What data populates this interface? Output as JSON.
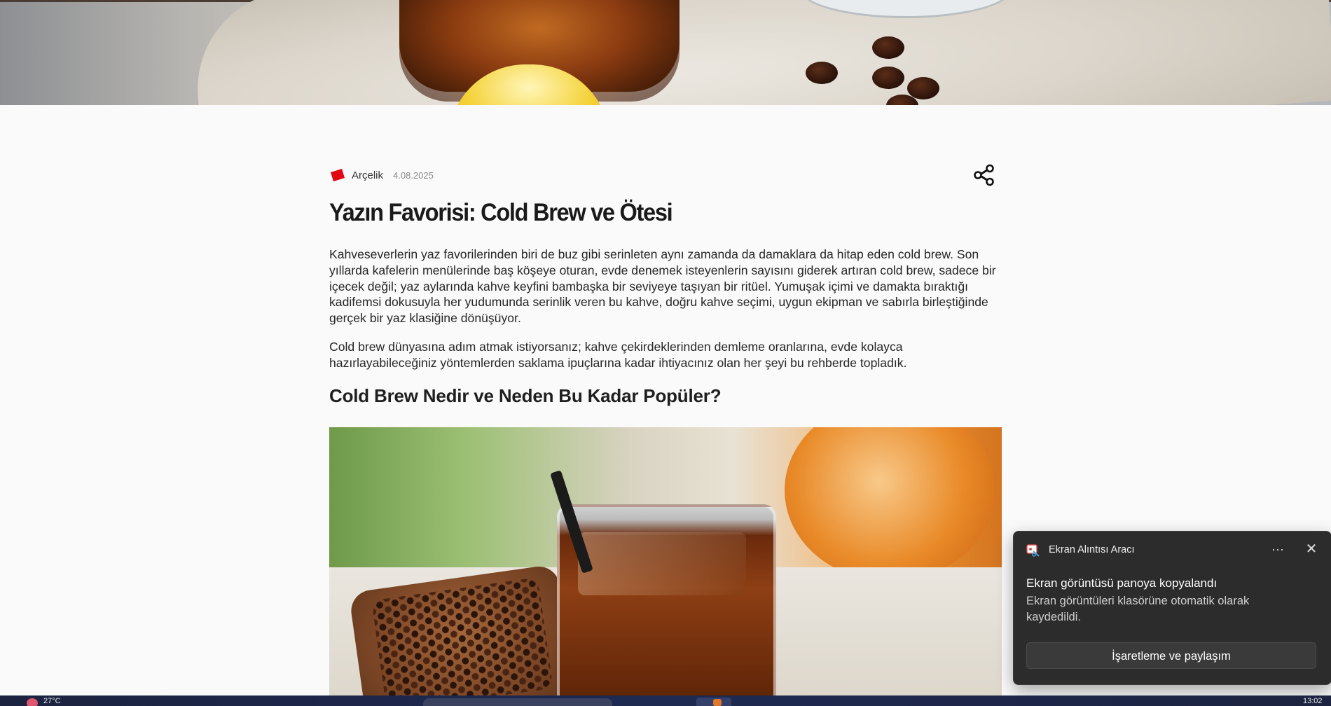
{
  "article": {
    "brand": "Arçelik",
    "date": "4.08.2025",
    "title": "Yazın Favorisi: Cold Brew ve Ötesi",
    "paragraphs": [
      "Kahveseverlerin yaz favorilerinden biri de buz gibi serinleten aynı zamanda da damaklara da hitap eden cold brew. Son yıllarda kafelerin menülerinde baş köşeye oturan, evde denemek isteyenlerin sayısını giderek artıran cold brew, sadece bir içecek değil; yaz aylarında kahve keyfini bambaşka bir seviyeye taşıyan bir ritüel. Yumuşak içimi ve damakta bıraktığı kadifemsi dokusuyla her yudumunda serinlik veren bu kahve, doğru kahve seçimi, uygun ekipman ve sabırla birleştiğinde gerçek bir yaz klasiğine dönüşüyor.",
      "Cold brew dünyasına adım atmak istiyorsanız; kahve çekirdeklerinden demleme oranlarına, evde kolayca hazırlayabileceğiniz yöntemlerden saklama ipuçlarına kadar ihtiyacınız olan her şeyi bu rehberde topladık."
    ],
    "subtitle": "Cold Brew Nedir ve Neden Bu Kadar Popüler?"
  },
  "toast": {
    "app_name": "Ekran Alıntısı Aracı",
    "more_label": "···",
    "close_label": "✕",
    "heading": "Ekran görüntüsü panoya kopyalandı",
    "body": "Ekran görüntüleri klasörüne otomatik olarak kaydedildi.",
    "button_label": "İşaretleme ve paylaşım"
  },
  "taskbar": {
    "weather_temp": "27°C",
    "clock": "13:02"
  },
  "colors": {
    "brand_red": "#e30613",
    "toast_bg": "#2c2c2c",
    "page_bg": "#fafafa"
  },
  "icons": {
    "share": "share-icon",
    "brand": "arcelik-logo-icon",
    "toast_app": "snipping-tool-icon"
  }
}
